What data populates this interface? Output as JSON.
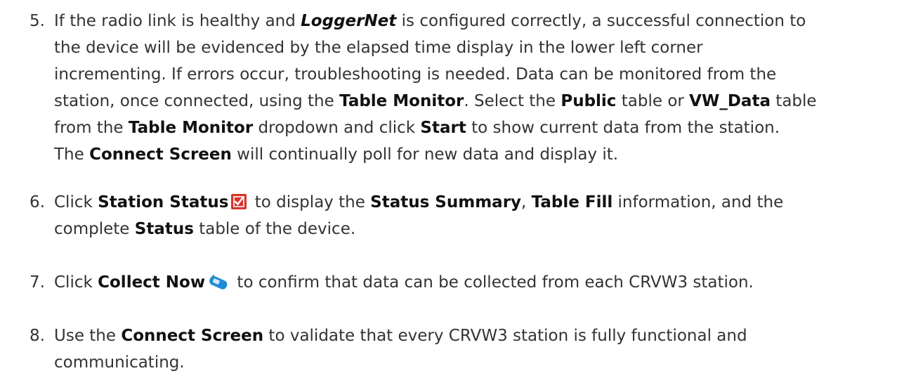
{
  "steps": [
    {
      "number": "5.",
      "lines": [
        [
          {
            "t": "If the radio link is healthy and ",
            "s": "n"
          },
          {
            "t": "LoggerNet",
            "s": "bi"
          },
          {
            "t": " is configured correctly, a successful connection to",
            "s": "n"
          }
        ],
        [
          {
            "t": "the device will be evidenced by the elapsed time display in the lower left corner",
            "s": "n"
          }
        ],
        [
          {
            "t": "incrementing. If errors occur, troubleshooting is needed. Data can be monitored from the",
            "s": "n"
          }
        ],
        [
          {
            "t": "station, once connected, using the ",
            "s": "n"
          },
          {
            "t": "Table Monitor",
            "s": "b"
          },
          {
            "t": ". Select the ",
            "s": "n"
          },
          {
            "t": "Public",
            "s": "b"
          },
          {
            "t": " table or ",
            "s": "n"
          },
          {
            "t": "VW_Data",
            "s": "b"
          },
          {
            "t": " table",
            "s": "n"
          }
        ],
        [
          {
            "t": "from the ",
            "s": "n"
          },
          {
            "t": "Table Monitor",
            "s": "b"
          },
          {
            "t": " dropdown and click ",
            "s": "n"
          },
          {
            "t": "Start",
            "s": "b"
          },
          {
            "t": " to show current data from the station.",
            "s": "n"
          }
        ],
        [
          {
            "t": "The ",
            "s": "n"
          },
          {
            "t": "Connect Screen",
            "s": "b"
          },
          {
            "t": " will continually poll for new data and display it.",
            "s": "n"
          }
        ]
      ]
    },
    {
      "number": "6.",
      "lines": [
        [
          {
            "t": "Click ",
            "s": "n"
          },
          {
            "t": "Station Status",
            "s": "b"
          },
          {
            "icon": "station-status-checkbox-icon"
          },
          {
            "t": " to display the ",
            "s": "n"
          },
          {
            "t": "Status Summary",
            "s": "b"
          },
          {
            "t": ", ",
            "s": "n"
          },
          {
            "t": "Table Fill",
            "s": "b"
          },
          {
            "t": " information, and the",
            "s": "n"
          }
        ],
        [
          {
            "t": "complete ",
            "s": "n"
          },
          {
            "t": "Status",
            "s": "b"
          },
          {
            "t": " table of the device.",
            "s": "n"
          }
        ]
      ]
    },
    {
      "number": "7.",
      "lines": [
        [
          {
            "t": "Click ",
            "s": "n"
          },
          {
            "t": "Collect Now",
            "s": "b"
          },
          {
            "icon": "collect-now-phone-icon"
          },
          {
            "t": " to confirm that data can be collected from each CRVW3 station.",
            "s": "n"
          }
        ]
      ]
    },
    {
      "number": "8.",
      "lines": [
        [
          {
            "t": "Use the ",
            "s": "n"
          },
          {
            "t": "Connect Screen",
            "s": "b"
          },
          {
            "t": " to validate that every CRVW3 station is fully functional and",
            "s": "n"
          }
        ],
        [
          {
            "t": "communicating.",
            "s": "n"
          }
        ]
      ]
    }
  ],
  "icons": {
    "station-status-checkbox-icon": {
      "fill": "#d9342b",
      "check": "#ffffff"
    },
    "collect-now-phone-icon": {
      "body": "#1e8bd8",
      "antenna": "#8a8a8a"
    }
  }
}
